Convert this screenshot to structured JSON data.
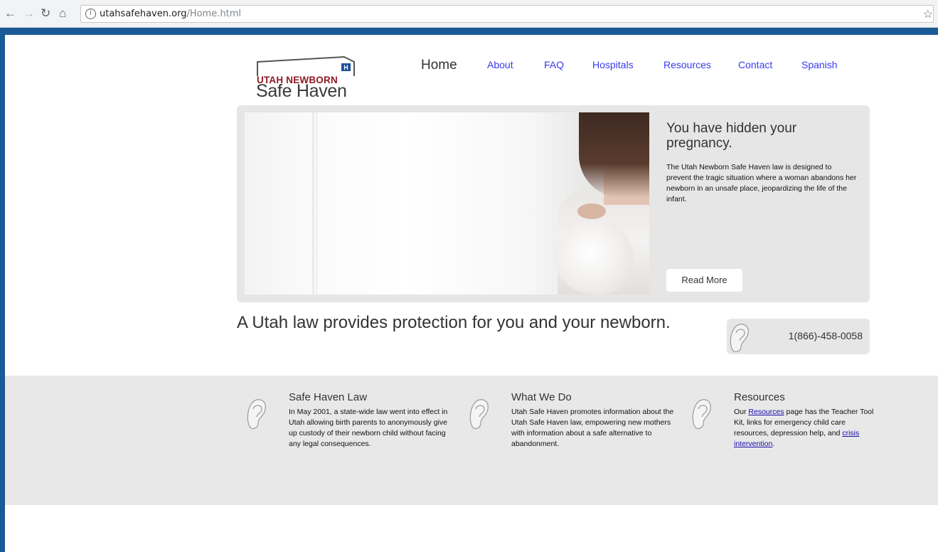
{
  "browser": {
    "url_host": "utahsafehaven.org",
    "url_path": "/Home.html",
    "back_icon": "back-arrow-icon",
    "forward_icon": "forward-arrow-icon",
    "reload_icon": "reload-icon",
    "home_icon": "home-icon",
    "info_icon": "info-icon",
    "bookmark_icon": "star-icon"
  },
  "logo": {
    "line1": "UTAH NEWBORN",
    "line2": "Safe Haven",
    "badge": "H"
  },
  "nav": {
    "items": [
      {
        "label": "Home",
        "active": true
      },
      {
        "label": "About"
      },
      {
        "label": "FAQ"
      },
      {
        "label": "Hospitals"
      },
      {
        "label": "Resources"
      },
      {
        "label": "Contact"
      },
      {
        "label": "Spanish"
      }
    ]
  },
  "hero": {
    "title": "You have hidden your pregnancy.",
    "body": "The Utah Newborn Safe Haven law is designed to prevent the tragic situation where a woman abandons her newborn in an unsafe place, jeopardizing the life of the infant.",
    "button": "Read More"
  },
  "tagline": "A Utah law provides protection for you and your newborn.",
  "phone": "1(866)-458-0058",
  "columns": [
    {
      "title": "Safe Haven Law",
      "body": "In May 2001, a state-wide law went into effect in Utah allowing birth parents to anonymously give up custody of their newborn child without facing any legal consequences."
    },
    {
      "title": "What We Do",
      "body": "Utah Safe Haven promotes information about the Utah Safe Haven law, empowering new mothers with information about a safe alternative to abandonment."
    },
    {
      "title": "Resources",
      "body_prefix": "Our ",
      "link1": "Resources",
      "body_middle": " page has the Teacher Tool Kit, links for emergency child care resources, depression help, and ",
      "link2": "crisis intervention",
      "body_suffix": "."
    }
  ],
  "colors": {
    "accent": "#1a5a96",
    "nav_link": "#3a3af0",
    "logo_red": "#8e1a24",
    "panel_gray": "#e6e6e6"
  }
}
